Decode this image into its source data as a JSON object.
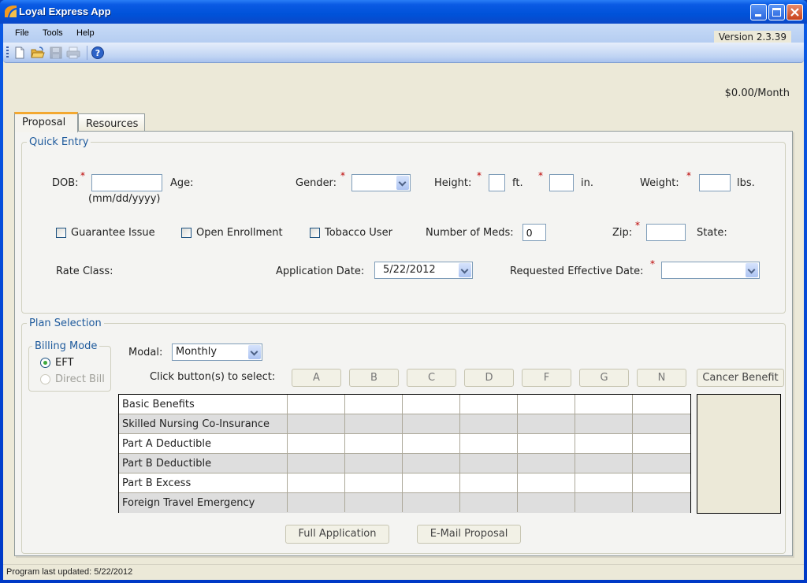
{
  "window": {
    "title": "Loyal Express App",
    "controls": [
      "minimize-icon",
      "maximize-icon",
      "close-icon"
    ]
  },
  "menu": {
    "items": [
      {
        "label": "File"
      },
      {
        "label": "Tools"
      },
      {
        "label": "Help"
      }
    ],
    "version": "Version  2.3.39"
  },
  "toolbar": {
    "icons": [
      "new-document-icon",
      "open-folder-icon",
      "save-icon",
      "print-icon",
      "help-icon"
    ]
  },
  "premium": "$0.00/Month",
  "tabs": [
    {
      "label": "Proposal",
      "active": true
    },
    {
      "label": "Resources",
      "active": false
    }
  ],
  "quick_entry": {
    "legend": "Quick Entry",
    "dob_label": "DOB:",
    "dob_value": "",
    "dob_hint": "(mm/dd/yyyy)",
    "age_label": "Age:",
    "gender_label": "Gender:",
    "gender_value": "",
    "height_label": "Height:",
    "height_ft_value": "",
    "ft_label": "ft.",
    "height_in_value": "",
    "in_label": "in.",
    "weight_label": "Weight:",
    "weight_value": "",
    "lbs_label": "lbs.",
    "required_mark": "*",
    "checkboxes": [
      {
        "label": "Guarantee Issue",
        "checked": false
      },
      {
        "label": "Open Enrollment",
        "checked": false
      },
      {
        "label": "Tobacco User",
        "checked": false
      }
    ],
    "meds_label": "Number of Meds:",
    "meds_value": "0",
    "zip_label": "Zip:",
    "zip_value": "",
    "state_label": "State:",
    "rate_class_label": "Rate Class:",
    "app_date_label": "Application Date:",
    "app_date_value": "5/22/2012",
    "eff_date_label": "Requested Effective Date:",
    "eff_date_value": ""
  },
  "plan_selection": {
    "legend": "Plan Selection",
    "billing_mode": {
      "legend": "Billing Mode",
      "options": [
        {
          "label": "EFT",
          "selected": true,
          "enabled": true
        },
        {
          "label": "Direct Bill",
          "selected": false,
          "enabled": false
        }
      ]
    },
    "modal_label": "Modal:",
    "modal_value": "Monthly",
    "select_prompt": "Click button(s) to select:",
    "plan_buttons": [
      "A",
      "B",
      "C",
      "D",
      "F",
      "G",
      "N"
    ],
    "cancer_button": "Cancer Benefit",
    "benefit_rows": [
      "Basic Benefits",
      "Skilled Nursing Co-Insurance",
      "Part A Deductible",
      "Part B Deductible",
      "Part B Excess",
      "Foreign Travel Emergency"
    ]
  },
  "actions": {
    "full_application": "Full Application",
    "email_proposal": "E-Mail Proposal"
  },
  "status": {
    "text": "Program last updated: 5/22/2012"
  }
}
